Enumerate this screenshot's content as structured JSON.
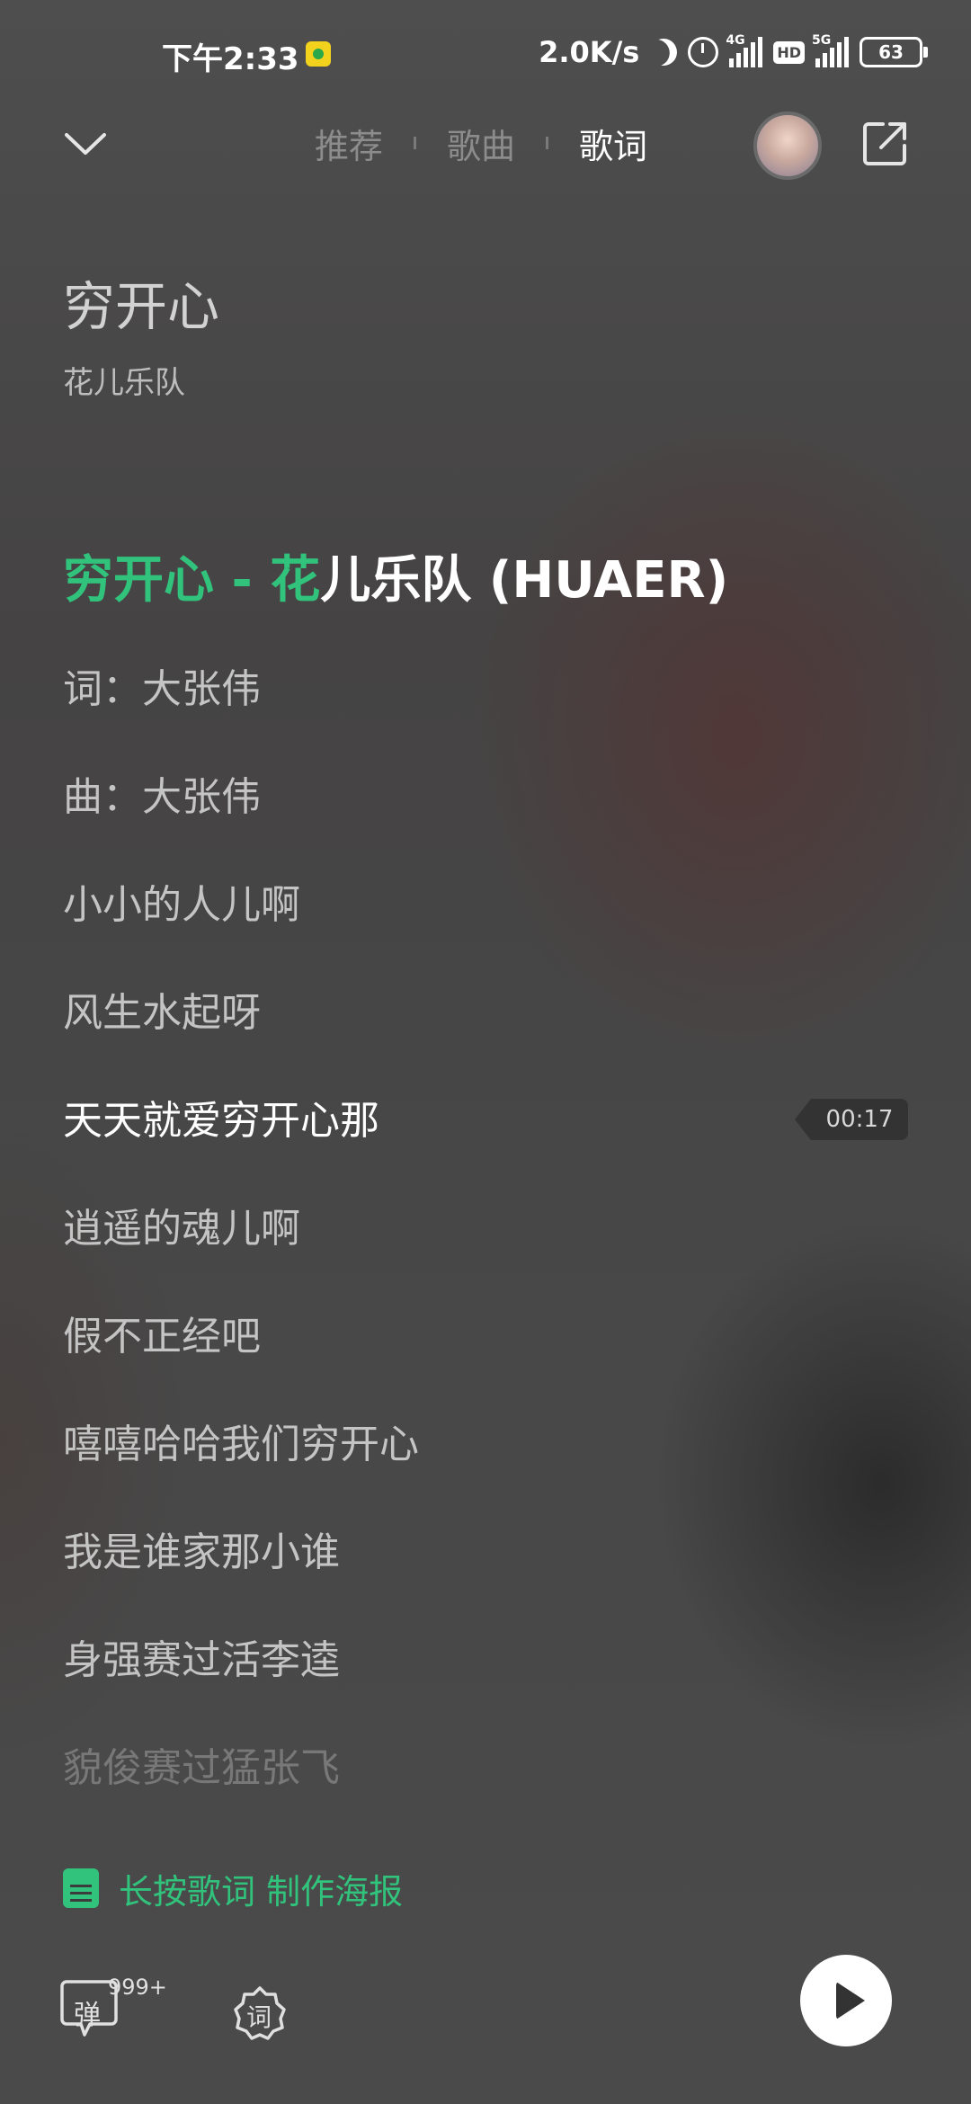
{
  "status_bar": {
    "time": "下午2:33",
    "net_speed": "2.0K/s",
    "signal_1_tag": "4G",
    "hd_label": "HD",
    "signal_2_tag": "5G",
    "battery": "63"
  },
  "nav": {
    "tabs": [
      {
        "label": "推荐",
        "active": false
      },
      {
        "label": "歌曲",
        "active": false
      },
      {
        "label": "歌词",
        "active": true
      }
    ]
  },
  "song": {
    "title": "穷开心",
    "artist": "花儿乐队"
  },
  "lyrics": {
    "header_sung": "穷开心 - 花",
    "header_unsung": "儿乐队 (HUAER)",
    "lines": [
      "词：大张伟",
      "曲：大张伟",
      "小小的人儿啊",
      "风生水起呀",
      "天天就爱穷开心那",
      "逍遥的魂儿啊",
      "假不正经吧",
      "嘻嘻哈哈我们穷开心",
      "我是谁家那小谁",
      "身强赛过活李逵",
      "貌俊赛过猛张飞"
    ],
    "current_index": 4,
    "current_time": "00:17"
  },
  "poster_hint": "长按歌词 制作海报",
  "controls": {
    "danmu_glyph": "弹",
    "danmu_count": "999+",
    "lyric_mode_glyph": "词"
  },
  "colors": {
    "accent": "#31c27c",
    "background": "#4a4a4a"
  },
  "icons": [
    "collapse-chevron-icon",
    "share-icon",
    "poster-icon",
    "danmu-icon",
    "lyric-mode-icon",
    "play-icon"
  ]
}
